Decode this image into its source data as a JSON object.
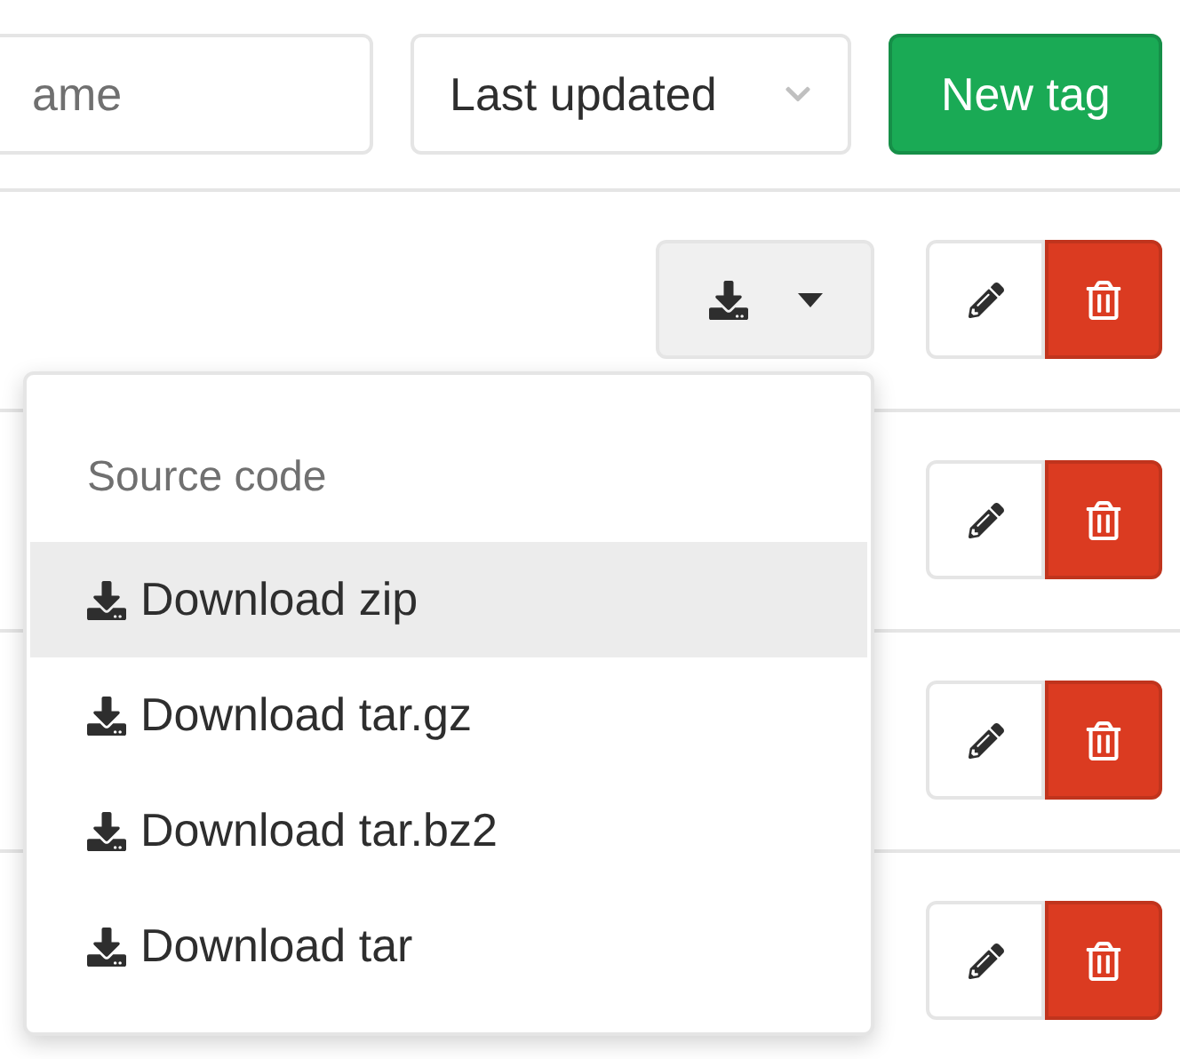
{
  "search": {
    "placeholder": "ame"
  },
  "sort": {
    "label": "Last updated"
  },
  "new_button": {
    "label": "New tag"
  },
  "rows": [
    {
      "kind": "download"
    },
    {
      "kind": "plain"
    },
    {
      "kind": "plain"
    },
    {
      "kind": "plain"
    }
  ],
  "menu": {
    "header": "Source code",
    "items": [
      {
        "label": "Download zip",
        "selected": true
      },
      {
        "label": "Download tar.gz",
        "selected": false
      },
      {
        "label": "Download tar.bz2",
        "selected": false
      },
      {
        "label": "Download tar",
        "selected": false
      }
    ]
  }
}
